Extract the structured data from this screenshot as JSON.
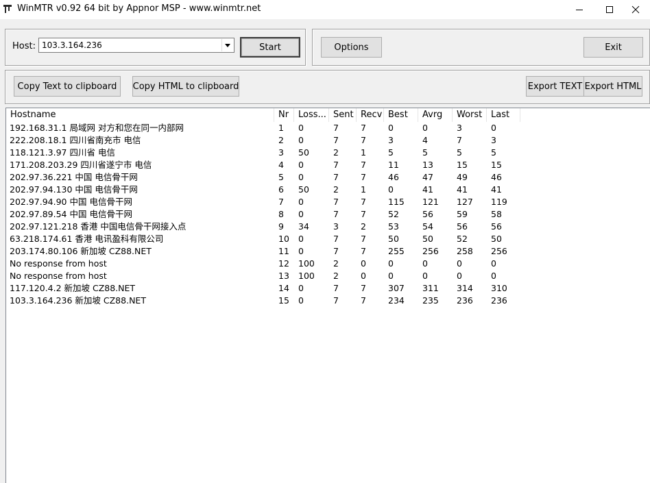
{
  "window": {
    "title": "WinMTR v0.92 64 bit by Appnor MSP - www.winmtr.net",
    "icons": {
      "app": "winmtr-app-icon",
      "minimize": "minimize-icon",
      "maximize": "maximize-icon",
      "close": "close-icon"
    }
  },
  "host_panel": {
    "host_label": "Host:",
    "host_value": "103.3.164.236",
    "start_label": "Start"
  },
  "options_panel": {
    "options_label": "Options",
    "exit_label": "Exit"
  },
  "export_panel": {
    "copy_text_label": "Copy Text to clipboard",
    "copy_html_label": "Copy HTML to clipboard",
    "export_text_label": "Export TEXT",
    "export_html_label": "Export HTML"
  },
  "table": {
    "columns": [
      "Hostname",
      "Nr",
      "Loss...",
      "Sent",
      "Recv",
      "Best",
      "Avrg",
      "Worst",
      "Last"
    ],
    "rows": [
      [
        "192.168.31.1 局域网 对方和您在同一内部网",
        "1",
        "0",
        "7",
        "7",
        "0",
        "0",
        "3",
        "0"
      ],
      [
        "222.208.18.1 四川省南充市 电信",
        "2",
        "0",
        "7",
        "7",
        "3",
        "4",
        "7",
        "3"
      ],
      [
        "118.121.3.97 四川省 电信",
        "3",
        "50",
        "2",
        "1",
        "5",
        "5",
        "5",
        "5"
      ],
      [
        "171.208.203.29 四川省遂宁市 电信",
        "4",
        "0",
        "7",
        "7",
        "11",
        "13",
        "15",
        "15"
      ],
      [
        "202.97.36.221 中国 电信骨干网",
        "5",
        "0",
        "7",
        "7",
        "46",
        "47",
        "49",
        "46"
      ],
      [
        "202.97.94.130 中国 电信骨干网",
        "6",
        "50",
        "2",
        "1",
        "0",
        "41",
        "41",
        "41"
      ],
      [
        "202.97.94.90 中国 电信骨干网",
        "7",
        "0",
        "7",
        "7",
        "115",
        "121",
        "127",
        "119"
      ],
      [
        "202.97.89.54 中国 电信骨干网",
        "8",
        "0",
        "7",
        "7",
        "52",
        "56",
        "59",
        "58"
      ],
      [
        "202.97.121.218 香港 中国电信骨干网接入点",
        "9",
        "34",
        "3",
        "2",
        "53",
        "54",
        "56",
        "56"
      ],
      [
        "63.218.174.61 香港 电讯盈科有限公司",
        "10",
        "0",
        "7",
        "7",
        "50",
        "50",
        "52",
        "50"
      ],
      [
        "203.174.80.106 新加坡  CZ88.NET",
        "11",
        "0",
        "7",
        "7",
        "255",
        "256",
        "258",
        "256"
      ],
      [
        "No response from host",
        "12",
        "100",
        "2",
        "0",
        "0",
        "0",
        "0",
        "0"
      ],
      [
        "No response from host",
        "13",
        "100",
        "2",
        "0",
        "0",
        "0",
        "0",
        "0"
      ],
      [
        "117.120.4.2 新加坡  CZ88.NET",
        "14",
        "0",
        "7",
        "7",
        "307",
        "311",
        "314",
        "310"
      ],
      [
        "103.3.164.236 新加坡  CZ88.NET",
        "15",
        "0",
        "7",
        "7",
        "234",
        "235",
        "236",
        "236"
      ]
    ]
  }
}
